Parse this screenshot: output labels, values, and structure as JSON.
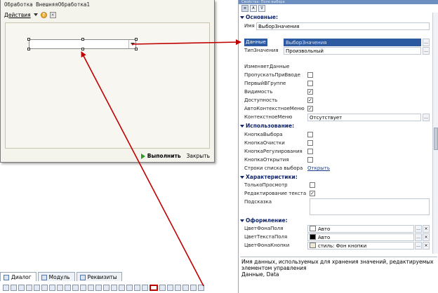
{
  "form_window": {
    "title": "Обработка ВнешняяОбработка1",
    "menu_actions": "Действия",
    "run_label": "Выполнить",
    "close_label": "Закрыть"
  },
  "bottom_tabs": [
    {
      "label": "Диалог",
      "active": true
    },
    {
      "label": "Модуль",
      "active": false
    },
    {
      "label": "Реквизиты",
      "active": false
    }
  ],
  "props": {
    "caption": "Свойства: Поле выбора",
    "sections": {
      "basic": "Основные:",
      "usage": "Использование:",
      "characteristics": "Характеристики:",
      "appearance": "Оформление:"
    },
    "basic": {
      "name_label": "Имя",
      "name_value": "ВыборЗначения",
      "data_label": "Данные",
      "data_value": "ВыборЗначения",
      "valuetype_label": "ТипЗначения",
      "valuetype_value": "Произвольный",
      "changes_data": "ИзменяетДанные",
      "skip_on_input": "ПропускатьПриВводе",
      "first_in_group": "ПервыйВГруппе",
      "visible": "Видимость",
      "enabled": "Доступность",
      "auto_context_menu": "АвтоКонтекстноеМеню",
      "context_menu_label": "КонтекстноеМеню",
      "context_menu_value": "Отсутствует"
    },
    "usage": {
      "choice_button": "КнопкаВыбора",
      "clear_button": "КнопкаОчистки",
      "spin_button": "КнопкаРегулирования",
      "open_button": "КнопкаОткрытия",
      "choice_list_label": "Строки списка выбора",
      "choice_list_link": "Открыть"
    },
    "characteristics": {
      "read_only": "ТолькоПросмотр",
      "text_edit": "Редактирование текста",
      "tooltip": "Подсказка"
    },
    "appearance": {
      "bg_label": "ЦветФонаПоля",
      "bg_value": "Авто",
      "text_label": "ЦветТекстаПоля",
      "text_value": "Авто",
      "btn_bg_label": "ЦветФонаКнопки",
      "btn_bg_value": "стиль: Фон кнопки"
    },
    "description": {
      "line1": "Имя данных, используемых для хранения значений, редактируемых",
      "line2": "элементом управления",
      "line3": "Данные, Data"
    }
  },
  "colors": {
    "accent": "#2c5aa0",
    "arrow": "#c00000",
    "section": "#10256b"
  },
  "icons": [
    "help-icon",
    "close-icon",
    "run-icon",
    "chevron-down-icon",
    "sort-icon",
    "ellipsis-icon"
  ]
}
